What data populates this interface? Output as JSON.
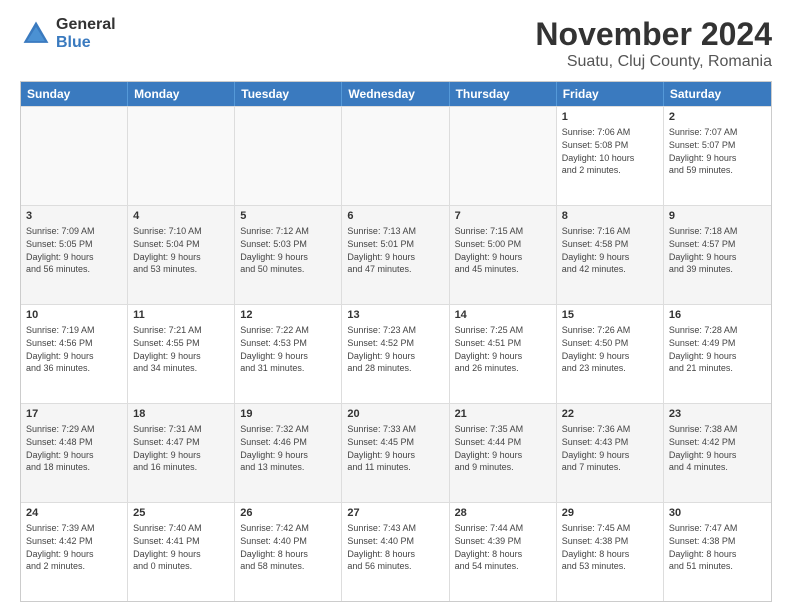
{
  "logo": {
    "general": "General",
    "blue": "Blue"
  },
  "title": {
    "month": "November 2024",
    "location": "Suatu, Cluj County, Romania"
  },
  "header_days": [
    "Sunday",
    "Monday",
    "Tuesday",
    "Wednesday",
    "Thursday",
    "Friday",
    "Saturday"
  ],
  "rows": [
    [
      {
        "day": "",
        "lines": []
      },
      {
        "day": "",
        "lines": []
      },
      {
        "day": "",
        "lines": []
      },
      {
        "day": "",
        "lines": []
      },
      {
        "day": "",
        "lines": []
      },
      {
        "day": "1",
        "lines": [
          "Sunrise: 7:06 AM",
          "Sunset: 5:08 PM",
          "Daylight: 10 hours",
          "and 2 minutes."
        ]
      },
      {
        "day": "2",
        "lines": [
          "Sunrise: 7:07 AM",
          "Sunset: 5:07 PM",
          "Daylight: 9 hours",
          "and 59 minutes."
        ]
      }
    ],
    [
      {
        "day": "3",
        "lines": [
          "Sunrise: 7:09 AM",
          "Sunset: 5:05 PM",
          "Daylight: 9 hours",
          "and 56 minutes."
        ]
      },
      {
        "day": "4",
        "lines": [
          "Sunrise: 7:10 AM",
          "Sunset: 5:04 PM",
          "Daylight: 9 hours",
          "and 53 minutes."
        ]
      },
      {
        "day": "5",
        "lines": [
          "Sunrise: 7:12 AM",
          "Sunset: 5:03 PM",
          "Daylight: 9 hours",
          "and 50 minutes."
        ]
      },
      {
        "day": "6",
        "lines": [
          "Sunrise: 7:13 AM",
          "Sunset: 5:01 PM",
          "Daylight: 9 hours",
          "and 47 minutes."
        ]
      },
      {
        "day": "7",
        "lines": [
          "Sunrise: 7:15 AM",
          "Sunset: 5:00 PM",
          "Daylight: 9 hours",
          "and 45 minutes."
        ]
      },
      {
        "day": "8",
        "lines": [
          "Sunrise: 7:16 AM",
          "Sunset: 4:58 PM",
          "Daylight: 9 hours",
          "and 42 minutes."
        ]
      },
      {
        "day": "9",
        "lines": [
          "Sunrise: 7:18 AM",
          "Sunset: 4:57 PM",
          "Daylight: 9 hours",
          "and 39 minutes."
        ]
      }
    ],
    [
      {
        "day": "10",
        "lines": [
          "Sunrise: 7:19 AM",
          "Sunset: 4:56 PM",
          "Daylight: 9 hours",
          "and 36 minutes."
        ]
      },
      {
        "day": "11",
        "lines": [
          "Sunrise: 7:21 AM",
          "Sunset: 4:55 PM",
          "Daylight: 9 hours",
          "and 34 minutes."
        ]
      },
      {
        "day": "12",
        "lines": [
          "Sunrise: 7:22 AM",
          "Sunset: 4:53 PM",
          "Daylight: 9 hours",
          "and 31 minutes."
        ]
      },
      {
        "day": "13",
        "lines": [
          "Sunrise: 7:23 AM",
          "Sunset: 4:52 PM",
          "Daylight: 9 hours",
          "and 28 minutes."
        ]
      },
      {
        "day": "14",
        "lines": [
          "Sunrise: 7:25 AM",
          "Sunset: 4:51 PM",
          "Daylight: 9 hours",
          "and 26 minutes."
        ]
      },
      {
        "day": "15",
        "lines": [
          "Sunrise: 7:26 AM",
          "Sunset: 4:50 PM",
          "Daylight: 9 hours",
          "and 23 minutes."
        ]
      },
      {
        "day": "16",
        "lines": [
          "Sunrise: 7:28 AM",
          "Sunset: 4:49 PM",
          "Daylight: 9 hours",
          "and 21 minutes."
        ]
      }
    ],
    [
      {
        "day": "17",
        "lines": [
          "Sunrise: 7:29 AM",
          "Sunset: 4:48 PM",
          "Daylight: 9 hours",
          "and 18 minutes."
        ]
      },
      {
        "day": "18",
        "lines": [
          "Sunrise: 7:31 AM",
          "Sunset: 4:47 PM",
          "Daylight: 9 hours",
          "and 16 minutes."
        ]
      },
      {
        "day": "19",
        "lines": [
          "Sunrise: 7:32 AM",
          "Sunset: 4:46 PM",
          "Daylight: 9 hours",
          "and 13 minutes."
        ]
      },
      {
        "day": "20",
        "lines": [
          "Sunrise: 7:33 AM",
          "Sunset: 4:45 PM",
          "Daylight: 9 hours",
          "and 11 minutes."
        ]
      },
      {
        "day": "21",
        "lines": [
          "Sunrise: 7:35 AM",
          "Sunset: 4:44 PM",
          "Daylight: 9 hours",
          "and 9 minutes."
        ]
      },
      {
        "day": "22",
        "lines": [
          "Sunrise: 7:36 AM",
          "Sunset: 4:43 PM",
          "Daylight: 9 hours",
          "and 7 minutes."
        ]
      },
      {
        "day": "23",
        "lines": [
          "Sunrise: 7:38 AM",
          "Sunset: 4:42 PM",
          "Daylight: 9 hours",
          "and 4 minutes."
        ]
      }
    ],
    [
      {
        "day": "24",
        "lines": [
          "Sunrise: 7:39 AM",
          "Sunset: 4:42 PM",
          "Daylight: 9 hours",
          "and 2 minutes."
        ]
      },
      {
        "day": "25",
        "lines": [
          "Sunrise: 7:40 AM",
          "Sunset: 4:41 PM",
          "Daylight: 9 hours",
          "and 0 minutes."
        ]
      },
      {
        "day": "26",
        "lines": [
          "Sunrise: 7:42 AM",
          "Sunset: 4:40 PM",
          "Daylight: 8 hours",
          "and 58 minutes."
        ]
      },
      {
        "day": "27",
        "lines": [
          "Sunrise: 7:43 AM",
          "Sunset: 4:40 PM",
          "Daylight: 8 hours",
          "and 56 minutes."
        ]
      },
      {
        "day": "28",
        "lines": [
          "Sunrise: 7:44 AM",
          "Sunset: 4:39 PM",
          "Daylight: 8 hours",
          "and 54 minutes."
        ]
      },
      {
        "day": "29",
        "lines": [
          "Sunrise: 7:45 AM",
          "Sunset: 4:38 PM",
          "Daylight: 8 hours",
          "and 53 minutes."
        ]
      },
      {
        "day": "30",
        "lines": [
          "Sunrise: 7:47 AM",
          "Sunset: 4:38 PM",
          "Daylight: 8 hours",
          "and 51 minutes."
        ]
      }
    ]
  ]
}
